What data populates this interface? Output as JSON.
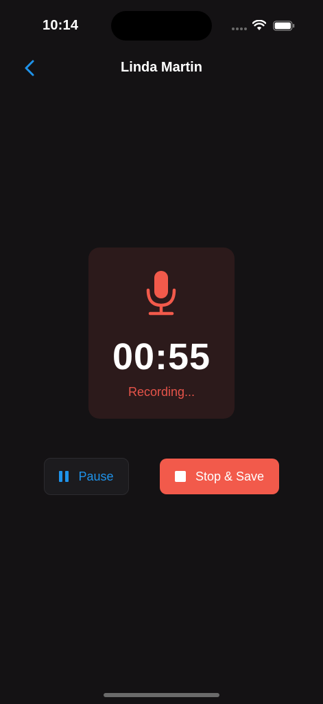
{
  "status_bar": {
    "time": "10:14",
    "icons": [
      "cellular-signal-icon",
      "wifi-icon",
      "battery-icon"
    ]
  },
  "nav": {
    "back_icon": "chevron-left-icon",
    "title": "Linda Martin"
  },
  "recording": {
    "icon": "microphone-icon",
    "timer": "00:55",
    "status": "Recording..."
  },
  "controls": {
    "pause_label": "Pause",
    "pause_icon": "pause-icon",
    "stop_label": "Stop & Save",
    "stop_icon": "stop-icon"
  },
  "colors": {
    "background": "#141214",
    "accent_blue": "#1f93ea",
    "recording_red": "#f25a4b",
    "card_background": "#2c1a1b",
    "status_red": "#e6544a"
  }
}
